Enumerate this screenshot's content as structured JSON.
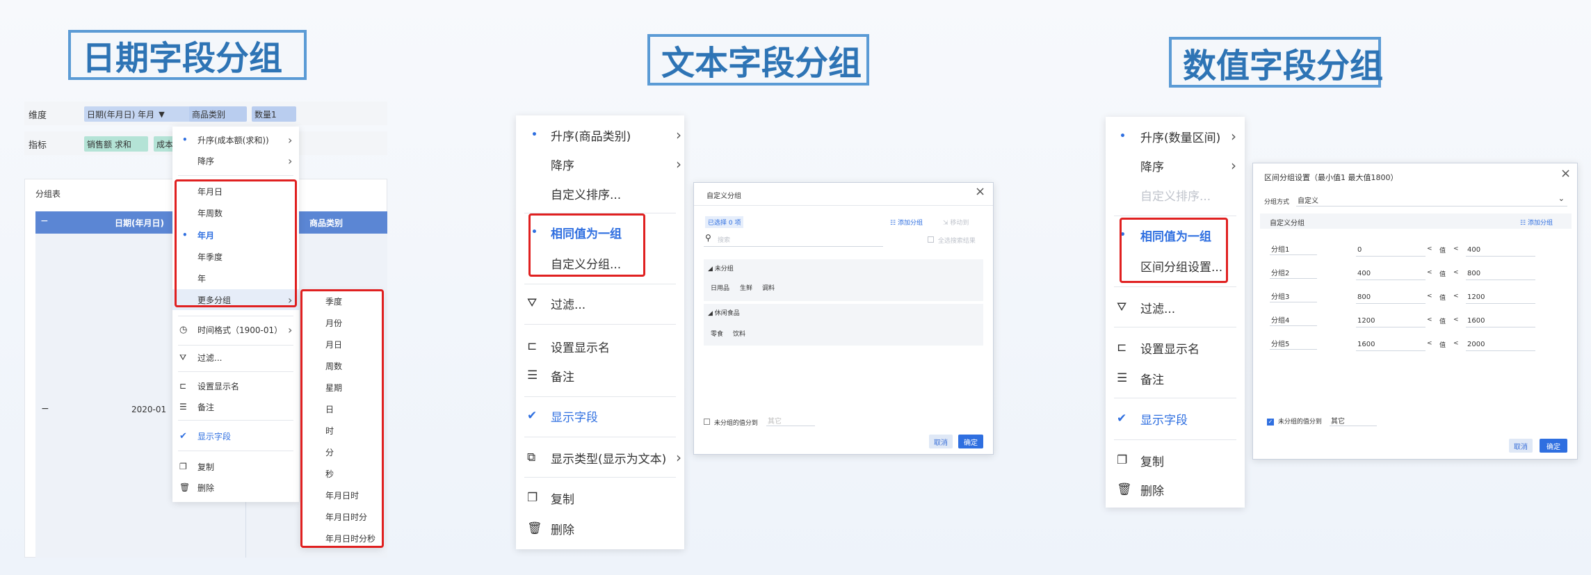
{
  "titles": {
    "date": "日期字段分组",
    "text": "文本字段分组",
    "num": "数值字段分组"
  },
  "colors": {
    "accent": "#2f6fe0",
    "highlight_border": "#e02020",
    "title_border": "#5b9bd5",
    "header_blue": "#5b86d4"
  },
  "date_panel": {
    "dimension_label": "维度",
    "metric_label": "指标",
    "dim_chips": [
      "日期(年月日) 年月",
      "商品类别",
      "数量1"
    ],
    "metric_chips": [
      "销售额 求和",
      "成本"
    ],
    "table_title": "分组表",
    "table_minus": "−",
    "table_headers": [
      "日期(年月日)",
      "商品类别"
    ],
    "row_minus": "−",
    "row_value": "2020-01",
    "menu": {
      "sort_asc": "升序(成本额(求和))",
      "sort_desc": "降序",
      "group_items": [
        "年月日",
        "年周数",
        "年月",
        "年季度",
        "年",
        "更多分组"
      ],
      "time_format": "时间格式（1900-01）",
      "filter": "过滤...",
      "display_name": "设置显示名",
      "remark": "备注",
      "show_field": "显示字段",
      "copy": "复制",
      "delete": "删除"
    },
    "submenu": [
      "季度",
      "月份",
      "月日",
      "周数",
      "星期",
      "日",
      "时",
      "分",
      "秒",
      "年月日时",
      "年月日时分",
      "年月日时分秒"
    ]
  },
  "text_panel": {
    "menu": {
      "sort_asc": "升序(商品类别)",
      "sort_desc": "降序",
      "custom_sort": "自定义排序...",
      "same_value": "相同值为一组",
      "custom_group": "自定义分组...",
      "filter": "过滤...",
      "display_name": "设置显示名",
      "remark": "备注",
      "show_field": "显示字段",
      "display_type": "显示类型(显示为文本)",
      "copy": "复制",
      "delete": "删除"
    },
    "dialog": {
      "title": "自定义分组",
      "selected": "已选择 0 项",
      "add_group": "添加分组",
      "move_to": "移动到",
      "search_placeholder": "搜索",
      "select_all": "全选搜索结果",
      "groups": [
        {
          "name": "未分组",
          "items": [
            "日用品",
            "生鲜",
            "调料"
          ]
        },
        {
          "name": "休闲食品",
          "items": [
            "零食",
            "饮料"
          ]
        }
      ],
      "ungrouped_label": "未分组的值分到",
      "ungrouped_value": "其它",
      "cancel": "取消",
      "ok": "确定"
    }
  },
  "num_panel": {
    "menu": {
      "sort_asc": "升序(数量区间)",
      "sort_desc": "降序",
      "custom_sort": "自定义排序...",
      "same_value": "相同值为一组",
      "range_group": "区间分组设置...",
      "filter": "过滤...",
      "display_name": "设置显示名",
      "remark": "备注",
      "show_field": "显示字段",
      "copy": "复制",
      "delete": "删除"
    },
    "dialog": {
      "title": "区间分组设置（最小值1 最大值1800）",
      "method_label": "分组方式",
      "method_value": "自定义",
      "custom_label": "自定义分组",
      "add_group": "添加分组",
      "op": "<",
      "val": "值",
      "rows": [
        {
          "name": "分组1",
          "low": "0",
          "high": "400"
        },
        {
          "name": "分组2",
          "low": "400",
          "high": "800"
        },
        {
          "name": "分组3",
          "low": "800",
          "high": "1200"
        },
        {
          "name": "分组4",
          "low": "1200",
          "high": "1600"
        },
        {
          "name": "分组5",
          "low": "1600",
          "high": "2000"
        }
      ],
      "ungrouped_label": "未分组的值分到",
      "ungrouped_value": "其它",
      "cancel": "取消",
      "ok": "确定"
    }
  }
}
